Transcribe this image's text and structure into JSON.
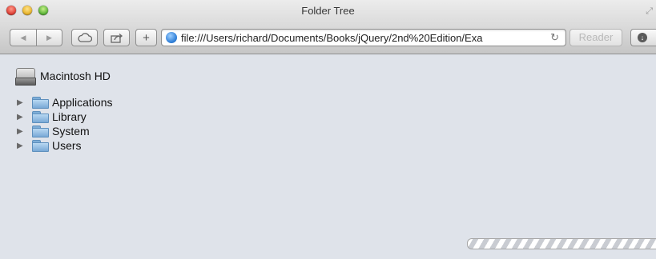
{
  "window": {
    "title": "Folder Tree"
  },
  "toolbar": {
    "back_icon": "back-arrow-icon",
    "forward_icon": "forward-arrow-icon",
    "cloud_icon": "icloud-tabs-icon",
    "share_icon": "share-icon",
    "add_label": "+",
    "address": {
      "url": "file:///Users/richard/Documents/Books/jQuery/2nd%20Edition/Exa",
      "reload_glyph": "↻"
    },
    "reader_label": "Reader",
    "downloads_icon": "downloads-icon"
  },
  "content": {
    "drive_label": "Macintosh HD",
    "tree": [
      {
        "label": "Applications",
        "disclosure": "▶"
      },
      {
        "label": "Library",
        "disclosure": "▶"
      },
      {
        "label": "System",
        "disclosure": "▶"
      },
      {
        "label": "Users",
        "disclosure": "▶"
      }
    ]
  },
  "colors": {
    "content_bg": "#dfe3ea",
    "folder_blue": "#79a9d6"
  }
}
